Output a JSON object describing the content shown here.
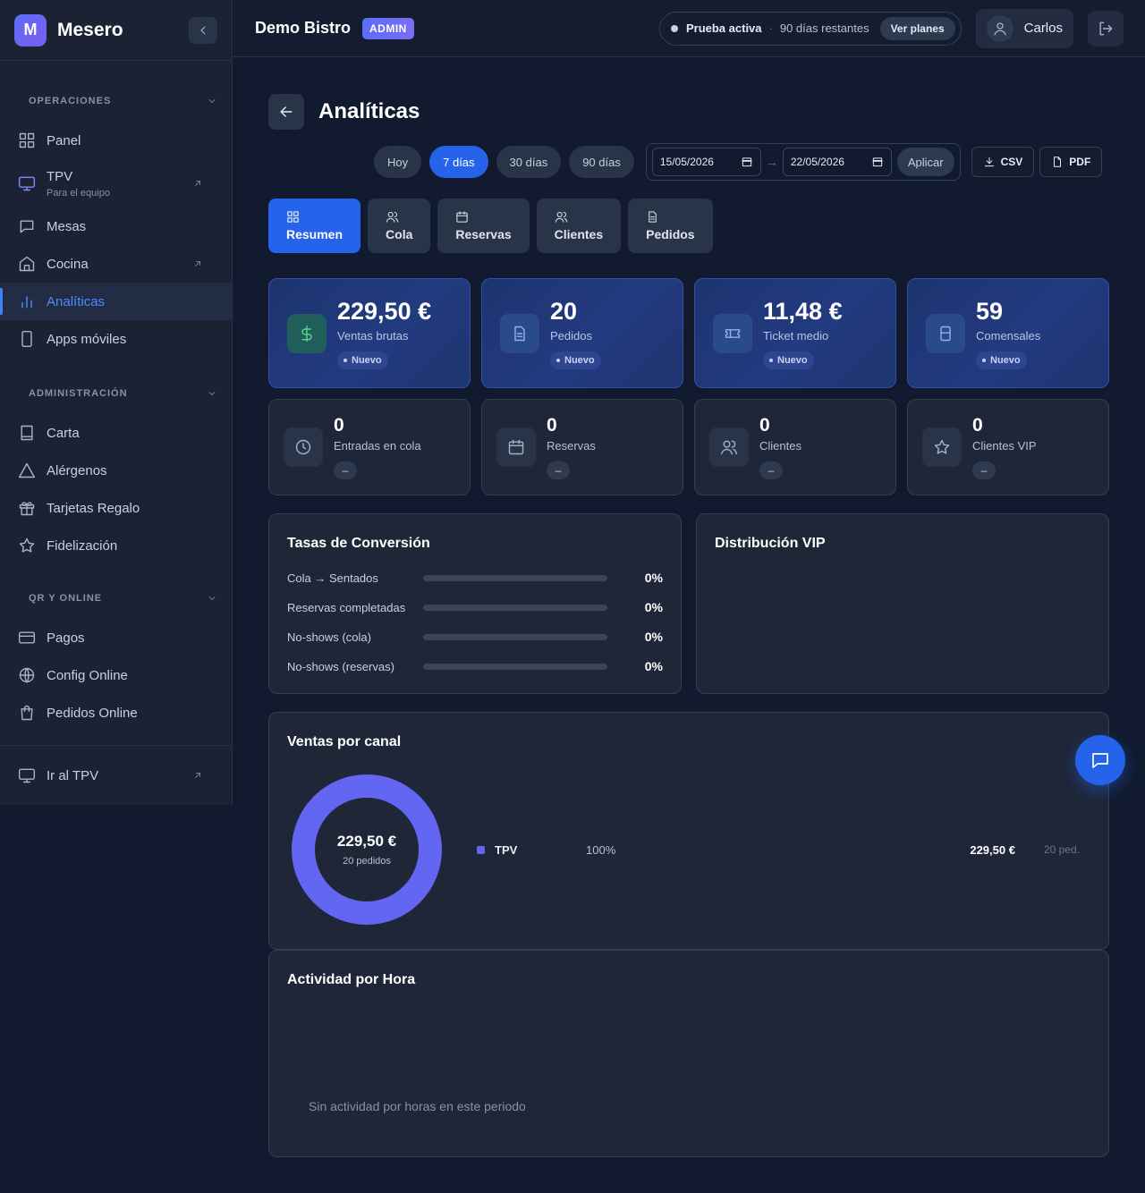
{
  "sidebar": {
    "logo_letter": "M",
    "brand": "Mesero",
    "sections": [
      {
        "title": "OPERACIONES",
        "items": [
          {
            "label": "Panel",
            "icon": "grid-icon"
          },
          {
            "label": "TPV",
            "sublabel": "Para el equipo",
            "icon": "monitor-icon",
            "external": true
          },
          {
            "label": "Mesas",
            "icon": "table-icon"
          },
          {
            "label": "Cocina",
            "icon": "home-icon",
            "external": true
          },
          {
            "label": "Analíticas",
            "icon": "bar-chart-icon",
            "active": true
          },
          {
            "label": "Apps móviles",
            "icon": "phone-icon"
          }
        ]
      },
      {
        "title": "ADMINISTRACIÓN",
        "items": [
          {
            "label": "Carta",
            "icon": "book-icon"
          },
          {
            "label": "Alérgenos",
            "icon": "alert-triangle-icon"
          },
          {
            "label": "Tarjetas Regalo",
            "icon": "gift-icon"
          },
          {
            "label": "Fidelización",
            "icon": "star-icon"
          }
        ]
      },
      {
        "title": "QR Y ONLINE",
        "items": [
          {
            "label": "Pagos",
            "icon": "credit-card-icon"
          },
          {
            "label": "Config Online",
            "icon": "globe-icon"
          },
          {
            "label": "Pedidos Online",
            "icon": "shopping-bag-icon"
          }
        ]
      }
    ],
    "footer_item": {
      "label": "Ir al TPV",
      "icon": "monitor-icon"
    }
  },
  "topbar": {
    "business_name": "Demo Bistro",
    "role_badge": "ADMIN",
    "trial_status": "Prueba activa",
    "trial_remaining": "90 días restantes",
    "plans_button": "Ver planes",
    "user_name": "Carlos"
  },
  "page": {
    "title": "Analíticas",
    "range_pills": [
      {
        "label": "Hoy",
        "active": false
      },
      {
        "label": "7 días",
        "active": true
      },
      {
        "label": "30 días",
        "active": false
      },
      {
        "label": "90 días",
        "active": false
      }
    ],
    "date_from": "15/05/2026",
    "date_to": "22/05/2026",
    "date_arrow": "→",
    "apply_button": "Aplicar",
    "export_csv": "CSV",
    "export_pdf": "PDF"
  },
  "tabs": [
    {
      "label": "Resumen",
      "icon": "grid-icon",
      "active": true
    },
    {
      "label": "Cola",
      "icon": "users-icon"
    },
    {
      "label": "Reservas",
      "icon": "calendar-icon"
    },
    {
      "label": "Clientes",
      "icon": "users-icon"
    },
    {
      "label": "Pedidos",
      "icon": "file-text-icon"
    }
  ],
  "kpis": [
    {
      "value": "229,50 €",
      "label": "Ventas brutas",
      "badge": "Nuevo",
      "icon": "dollar-icon"
    },
    {
      "value": "20",
      "label": "Pedidos",
      "badge": "Nuevo",
      "icon": "file-text-icon"
    },
    {
      "value": "11,48 €",
      "label": "Ticket medio",
      "badge": "Nuevo",
      "icon": "ticket-icon"
    },
    {
      "value": "59",
      "label": "Comensales",
      "badge": "Nuevo",
      "icon": "chair-icon"
    }
  ],
  "stats": [
    {
      "value": "0",
      "label": "Entradas en cola",
      "badge": "–",
      "icon": "clock-icon"
    },
    {
      "value": "0",
      "label": "Reservas",
      "badge": "–",
      "icon": "calendar-icon"
    },
    {
      "value": "0",
      "label": "Clientes",
      "badge": "–",
      "icon": "users-icon"
    },
    {
      "value": "0",
      "label": "Clientes VIP",
      "badge": "–",
      "icon": "star-icon"
    }
  ],
  "conversion": {
    "title": "Tasas de Conversión",
    "rows": [
      {
        "label": "Cola → Sentados",
        "value": "0%",
        "fraction": 0
      },
      {
        "label": "Reservas completadas",
        "value": "0%",
        "fraction": 0
      },
      {
        "label": "No-shows (cola)",
        "value": "0%",
        "fraction": 0
      },
      {
        "label": "No-shows (reservas)",
        "value": "0%",
        "fraction": 0
      }
    ]
  },
  "vip": {
    "title": "Distribución VIP"
  },
  "channel": {
    "title": "Ventas por canal",
    "total": "229,50 €",
    "total_sub": "20 pedidos"
  },
  "hourly": {
    "title": "Actividad por Hora",
    "empty_message": "Sin actividad por horas en este periodo"
  },
  "chart_data": {
    "type": "pie",
    "categories": [
      "TPV"
    ],
    "values": [
      229.5
    ],
    "series": [
      {
        "name": "TPV",
        "percent": "100%",
        "amount": "229,50 €",
        "orders": "20 ped.",
        "value": 100,
        "color": "#6366f1"
      }
    ]
  },
  "colors": {
    "accent": "#2563eb",
    "donut": "#6366f1",
    "bg": "#111a2e"
  }
}
